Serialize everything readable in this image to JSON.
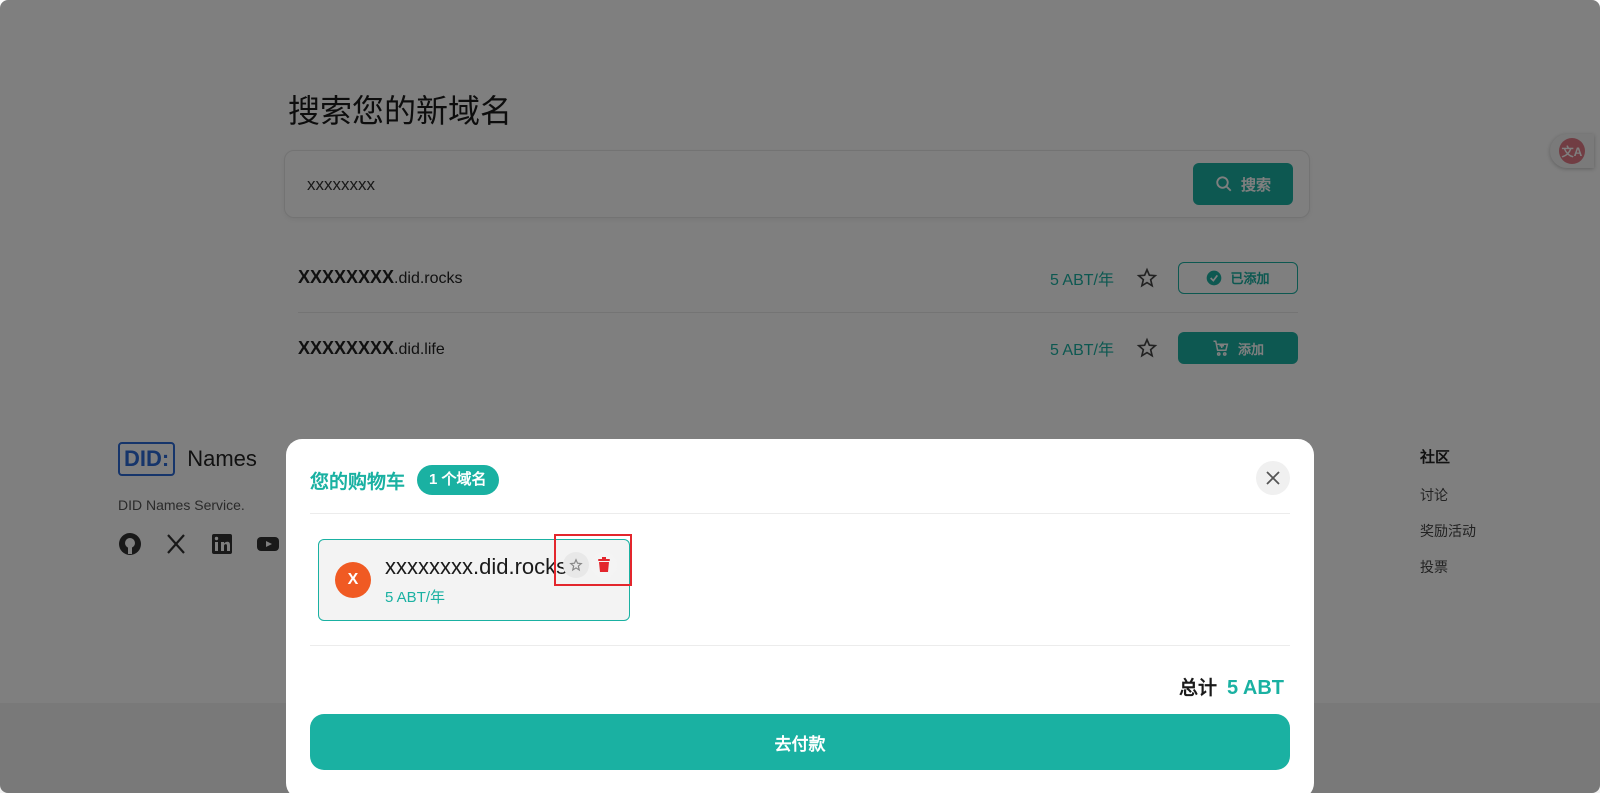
{
  "page": {
    "title": "搜索您的新域名",
    "search": {
      "value": "xxxxxxxx",
      "button_label": "搜索"
    },
    "results": [
      {
        "name_bold": "XXXXXXXX",
        "name_suffix": ".did.rocks",
        "price": "5 ABT/年",
        "action_label": "已添加",
        "status": "added"
      },
      {
        "name_bold": "XXXXXXXX",
        "name_suffix": ".did.life",
        "price": "5 ABT/年",
        "action_label": "添加",
        "status": "add"
      }
    ],
    "footer": {
      "logo_box": "DID:",
      "logo_text": "Names",
      "description": "DID Names Service.",
      "social_icons": [
        "github-icon",
        "x-icon",
        "linkedin-icon",
        "youtube-icon"
      ],
      "community": {
        "heading": "社区",
        "links": [
          "讨论",
          "奖励活动",
          "投票"
        ]
      }
    },
    "translate_label": "文A"
  },
  "cart": {
    "title": "您的购物车",
    "count_badge": "1 个域名",
    "items": [
      {
        "avatar_letter": "X",
        "name": "xxxxxxxx.did.rocks",
        "price": "5 ABT/年"
      }
    ],
    "total_label": "总计",
    "total_value": "5 ABT",
    "pay_button": "去付款"
  },
  "colors": {
    "accent": "#1ab1a2",
    "avatar": "#f05a23",
    "delete": "#e3262d"
  }
}
